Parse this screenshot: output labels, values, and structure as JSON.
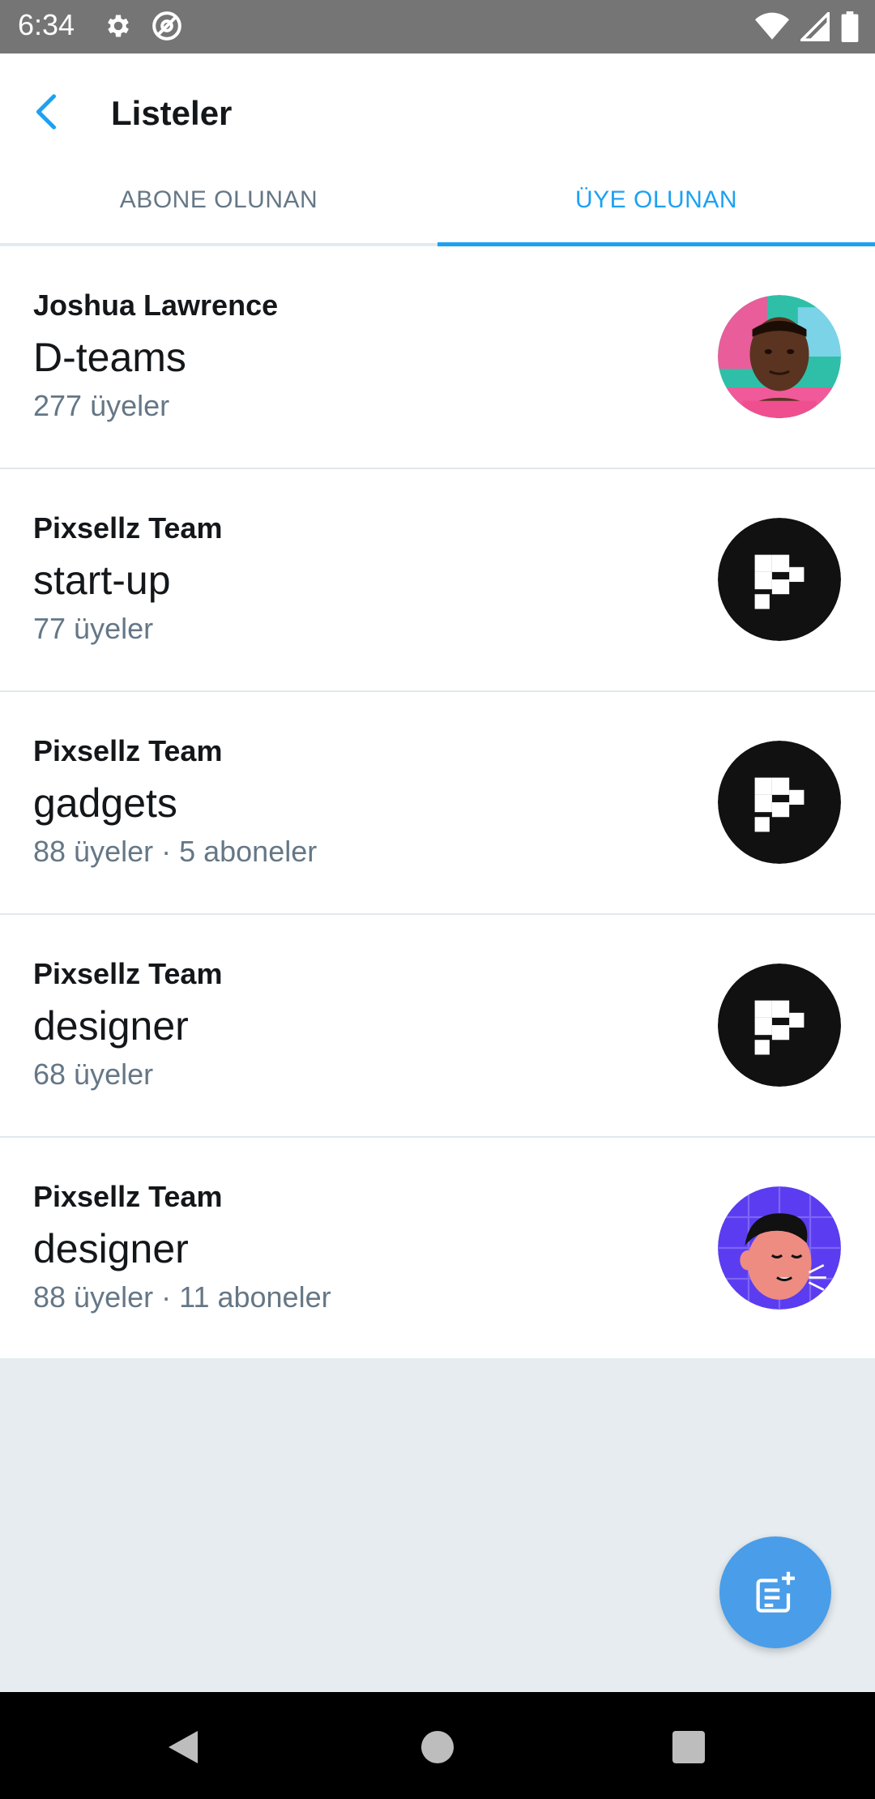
{
  "status_bar": {
    "time": "6:34",
    "icons_left": [
      "gear-icon",
      "at-icon"
    ],
    "icons_right": [
      "wifi-icon",
      "signal-icon",
      "battery-icon"
    ]
  },
  "app_bar": {
    "title": "Listeler",
    "back_icon": "chevron-left-icon",
    "accent_color": "#1da1f2"
  },
  "tabs": [
    {
      "label": "ABONE OLUNAN",
      "active": false
    },
    {
      "label": "ÜYE OLUNAN",
      "active": true
    }
  ],
  "lists": [
    {
      "owner": "Joshua Lawrence",
      "name": "D-teams",
      "meta": "277 üyeler",
      "avatar": "person-photo"
    },
    {
      "owner": "Pixsellz Team",
      "name": "start-up",
      "meta": "77 üyeler",
      "avatar": "pixsellz-logo"
    },
    {
      "owner": "Pixsellz Team",
      "name": "gadgets",
      "meta": "88 üyeler · 5 aboneler",
      "avatar": "pixsellz-logo"
    },
    {
      "owner": "Pixsellz Team",
      "name": "designer",
      "meta": "68 üyeler",
      "avatar": "pixsellz-logo"
    },
    {
      "owner": "Pixsellz Team",
      "name": "designer",
      "meta": "88 üyeler · 11 aboneler",
      "avatar": "illustrated-face"
    }
  ],
  "fab": {
    "icon": "new-list-icon",
    "color": "#4a9de8"
  },
  "nav_bar": {
    "icons": [
      "nav-back-icon",
      "nav-home-icon",
      "nav-recents-icon"
    ]
  }
}
